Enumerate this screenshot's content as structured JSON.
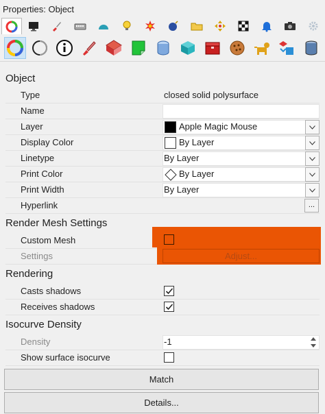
{
  "window": {
    "title": "Properties: Object"
  },
  "tabs": [
    {
      "icon": "color-wheel-icon",
      "active": true
    },
    {
      "icon": "monitor-icon"
    },
    {
      "icon": "brush-icon"
    },
    {
      "icon": "keyboard-icon"
    },
    {
      "icon": "dome-icon"
    },
    {
      "icon": "lightbulb-icon"
    },
    {
      "icon": "starburst-icon"
    },
    {
      "icon": "bomb-icon"
    },
    {
      "icon": "folder-icon"
    },
    {
      "icon": "move-arrows-icon"
    },
    {
      "icon": "checker-icon"
    },
    {
      "icon": "bell-icon"
    },
    {
      "icon": "camera-icon"
    },
    {
      "icon": "gear-icon"
    }
  ],
  "toolbar_icons": [
    "color-wheel-icon",
    "circle-outline-icon",
    "info-icon",
    "paint-pen-icon",
    "texture-box-icon",
    "green-page-icon",
    "cylinder-icon",
    "teal-cube-icon",
    "red-box-icon",
    "cookie-icon",
    "dog-icon",
    "transfer-icon",
    "database-icon"
  ],
  "sections": {
    "object": "Object",
    "render_mesh": "Render Mesh Settings",
    "rendering": "Rendering",
    "isocurve": "Isocurve Density"
  },
  "object": {
    "type_label": "Type",
    "type_value": "closed solid polysurface",
    "name_label": "Name",
    "name_value": "",
    "layer_label": "Layer",
    "layer_value": "Apple Magic Mouse",
    "display_color_label": "Display Color",
    "display_color_value": "By Layer",
    "linetype_label": "Linetype",
    "linetype_value": "By Layer",
    "print_color_label": "Print Color",
    "print_color_value": "By Layer",
    "print_width_label": "Print Width",
    "print_width_value": "By Layer",
    "hyperlink_label": "Hyperlink",
    "hyperlink_button": "..."
  },
  "render_mesh": {
    "custom_mesh_label": "Custom Mesh",
    "settings_label": "Settings",
    "adjust_button": "Adjust..."
  },
  "rendering": {
    "casts_label": "Casts shadows",
    "casts_checked": true,
    "receives_label": "Receives shadows",
    "receives_checked": true
  },
  "isocurve": {
    "density_label": "Density",
    "density_value": "-1",
    "show_label": "Show surface isocurve",
    "show_checked": false
  },
  "buttons": {
    "match": "Match",
    "details": "Details..."
  },
  "colors": {
    "highlight": "#ea5504",
    "selected_tab": "#cce4f7"
  }
}
